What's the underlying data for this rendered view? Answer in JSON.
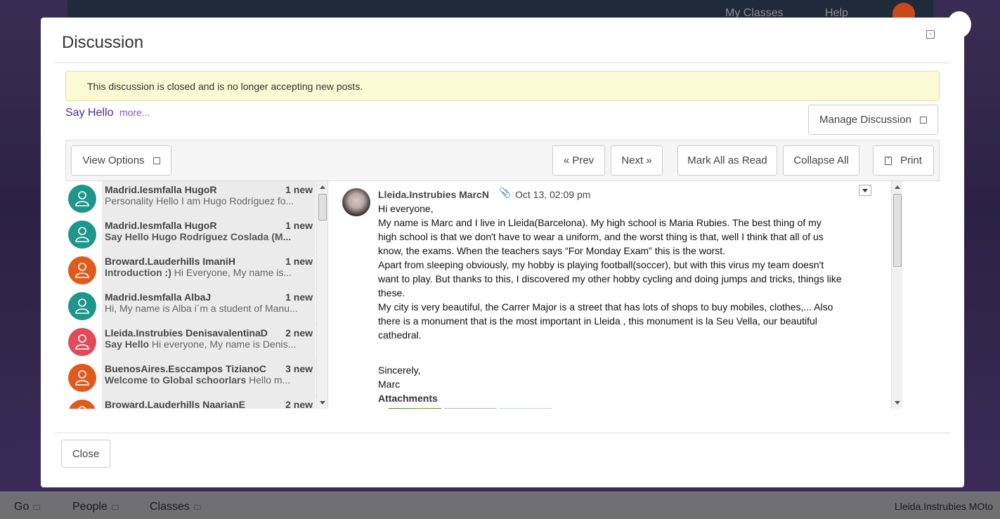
{
  "background": {
    "nav": [
      "My Classes",
      "Help"
    ],
    "bottom_bar": [
      "Go",
      "People",
      "Classes"
    ],
    "user": "Lleida.Instrubies MOto"
  },
  "modal": {
    "title": "Discussion",
    "notice": "This discussion is closed and is no longer accepting new posts.",
    "topic_title": "Say Hello",
    "topic_more": "more...",
    "manage_label": "Manage Discussion",
    "close_label": "Close"
  },
  "toolbar": {
    "view_options": "View Options",
    "prev": "« Prev",
    "next": "Next »",
    "mark_all_read": "Mark All as Read",
    "collapse_all": "Collapse All",
    "print": "Print"
  },
  "colors": {
    "teal": "#1e968a",
    "orange": "#e05a1c",
    "pink": "#e04a5a"
  },
  "threads": [
    {
      "author": "Madrid.Iesmfalla HugoR",
      "new": "1 new",
      "subject": "",
      "preview": "Personality Hello I am Hugo Rodríguez fo...",
      "color": "#1e968a"
    },
    {
      "author": "Madrid.Iesmfalla HugoR",
      "new": "1 new",
      "subject": "Say Hello Hugo Rodríguez Coslada (M...",
      "preview": "",
      "color": "#1e968a"
    },
    {
      "author": "Broward.Lauderhills ImaniH",
      "new": "1 new",
      "subject": "Introduction :)",
      "preview": "Hi Everyone,   My name is...",
      "color": "#e05a1c"
    },
    {
      "author": "Madrid.Iesmfalla AlbaJ",
      "new": "1 new",
      "subject": "",
      "preview": "Hi, My name is Alba i´m a student of Manu...",
      "color": "#1e968a"
    },
    {
      "author": "Lleida.Instrubies DenisavalentinaD",
      "new": "2 new",
      "subject": "Say Hello",
      "preview": "Hi everyone, My name is Denis...",
      "color": "#e04a5a"
    },
    {
      "author": "BuenosAires.Esccampos TizianoC",
      "new": "3 new",
      "subject": "Welcome to Global schoorlars",
      "preview": "Hello m...",
      "color": "#e05a1c"
    },
    {
      "author": "Broward.Lauderhills NaarianE",
      "new": "2 new",
      "subject": "",
      "preview": "",
      "color": "#e05a1c"
    }
  ],
  "post": {
    "author": "Lleida.Instrubies MarcN",
    "date": "Oct 13, 02:09 pm",
    "paragraphs": [
      "Hi everyone,",
      "My name is Marc and I live in Lleida(Barcelona). My high school is Maria Rubies. The best thing of my high school is that we don't have to wear a uniform, and the worst thing is that, well I think that  all of us know, the exams. When the teachers says “For Monday Exam” this is the worst.",
      "Apart from sleeping obviously, my hobby is playing football(soccer), but with this virus my team doesn't want to play. But thanks to this, I discovered my other hobby cycling and doing jumps and tricks, things like these.",
      "My city is very beautiful, the Carrer Major is a street that has lots of shops to buy mobiles, clothes,... Also there is a monument that is the most important in Lleida , this monument is la Seu Vella, our beautiful cathedral."
    ],
    "signoff_1": "Sincerely,",
    "signoff_2": "Marc",
    "attachments_label": "Attachments"
  }
}
